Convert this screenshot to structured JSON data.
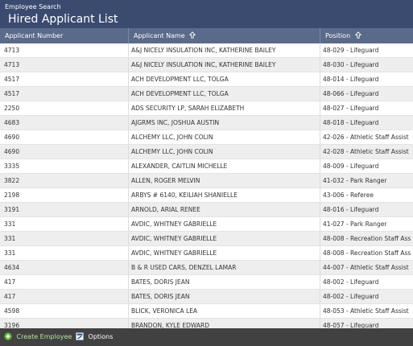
{
  "header": {
    "breadcrumb": "Employee Search",
    "title": "Hired Applicant List"
  },
  "columns": {
    "applicant_number": "Applicant Number",
    "applicant_name": "Applicant Name",
    "position": "Position"
  },
  "icons": {
    "sort": "sort-up-arrow-icon",
    "create": "plus-circle-icon",
    "options": "options-icon"
  },
  "colors": {
    "header_bg": "#3b4b70",
    "column_header_bg": "#5a6a8a",
    "footer_bg": "#414141",
    "create_icon": "#5cb82e"
  },
  "rows": [
    {
      "number": "4713",
      "name": "A&J NICELY INSULATION INC, KATHERINE BAILEY",
      "position": "48-029 - Lifeguard"
    },
    {
      "number": "4713",
      "name": "A&J NICELY INSULATION INC, KATHERINE BAILEY",
      "position": "48-030 - Lifeguard"
    },
    {
      "number": "4517",
      "name": "ACH DEVELOPMENT LLC, TOLGA",
      "position": "48-014 - Lifeguard"
    },
    {
      "number": "4517",
      "name": "ACH DEVELOPMENT LLC, TOLGA",
      "position": "48-066 - Lifeguard"
    },
    {
      "number": "2250",
      "name": "ADS SECURITY LP, SARAH ELIZABETH",
      "position": "48-027 - Lifeguard"
    },
    {
      "number": "4683",
      "name": "AJGRMS INC, JOSHUA AUSTIN",
      "position": "48-018 - Lifeguard"
    },
    {
      "number": "4690",
      "name": "ALCHEMY LLC, JOHN COLIN",
      "position": "42-026 - Athletic Staff Assist"
    },
    {
      "number": "4690",
      "name": "ALCHEMY LLC, JOHN COLIN",
      "position": "42-028 - Athletic Staff Assist"
    },
    {
      "number": "3335",
      "name": "ALEXANDER, CAITLIN MICHELLE",
      "position": "48-009 - Lifeguard"
    },
    {
      "number": "3822",
      "name": "ALLEN, ROGER MELVIN",
      "position": "41-032 - Park Ranger"
    },
    {
      "number": "2198",
      "name": "ARBYS # 6140, KEILIAH SHANIELLE",
      "position": "43-006 - Referee"
    },
    {
      "number": "3191",
      "name": "ARNOLD, ARIAL RENEE",
      "position": "48-016 - Lifeguard"
    },
    {
      "number": "331",
      "name": "AVDIC, WHITNEY GABRIELLE",
      "position": "41-027 - Park Ranger"
    },
    {
      "number": "331",
      "name": "AVDIC, WHITNEY GABRIELLE",
      "position": "48-008 - Recreation Staff Ass"
    },
    {
      "number": "331",
      "name": "AVDIC, WHITNEY GABRIELLE",
      "position": "48-008 - Recreation Staff Ass"
    },
    {
      "number": "4634",
      "name": "B & R USED CARS, DENZEL LAMAR",
      "position": "44-007 - Athletic Staff Assist"
    },
    {
      "number": "417",
      "name": "BATES, DORIS JEAN",
      "position": "48-002 - Lifeguard"
    },
    {
      "number": "417",
      "name": "BATES, DORIS JEAN",
      "position": "48-002 - Lifeguard"
    },
    {
      "number": "4598",
      "name": "BLICK, VERONICA LEA",
      "position": "48-053 - Athletic Staff Assist"
    },
    {
      "number": "3196",
      "name": "BRANDON, KYLE EDWARD",
      "position": "48-057 - Lifeguard"
    }
  ],
  "footer": {
    "create_label": "Create Employee",
    "options_label": "Options"
  }
}
